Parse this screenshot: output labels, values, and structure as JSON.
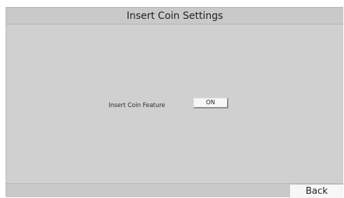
{
  "header": {
    "title": "Insert Coin Settings"
  },
  "settings": {
    "insert_coin": {
      "label": "Insert Coin Feature",
      "value": "ON"
    }
  },
  "footer": {
    "back_label": "Back"
  }
}
